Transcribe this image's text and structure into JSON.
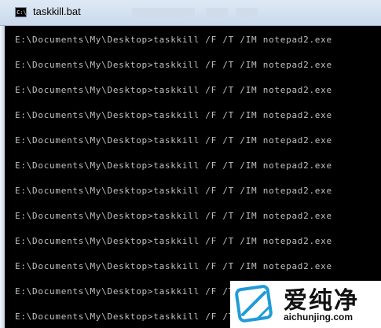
{
  "window": {
    "title": "taskkill.bat",
    "icon": "cmd-icon",
    "icon_text": "C:\\."
  },
  "console": {
    "lines": [
      "E:\\Documents\\My\\Desktop>taskkill /F /T /IM notepad2.exe",
      "E:\\Documents\\My\\Desktop>taskkill /F /T /IM notepad2.exe",
      "E:\\Documents\\My\\Desktop>taskkill /F /T /IM notepad2.exe",
      "E:\\Documents\\My\\Desktop>taskkill /F /T /IM notepad2.exe",
      "E:\\Documents\\My\\Desktop>taskkill /F /T /IM notepad2.exe",
      "E:\\Documents\\My\\Desktop>taskkill /F /T /IM notepad2.exe",
      "E:\\Documents\\My\\Desktop>taskkill /F /T /IM notepad2.exe",
      "E:\\Documents\\My\\Desktop>taskkill /F /T /IM notepad2.exe",
      "E:\\Documents\\My\\Desktop>taskkill /F /T /IM notepad2.exe",
      "E:\\Documents\\My\\Desktop>taskkill /F /T /IM notepad2.exe",
      "E:\\Documents\\My\\Desktop>taskkill /F /T /IM notepad2.exe",
      "E:\\Documents\\My\\Desktop>taskkill /F /T /IM notepad2.exe"
    ],
    "text_color": "#c0c0c0",
    "background": "#000000"
  },
  "watermark": {
    "name": "爱纯净",
    "url": "aichunjing.com",
    "accent": "#1f9bd7"
  }
}
